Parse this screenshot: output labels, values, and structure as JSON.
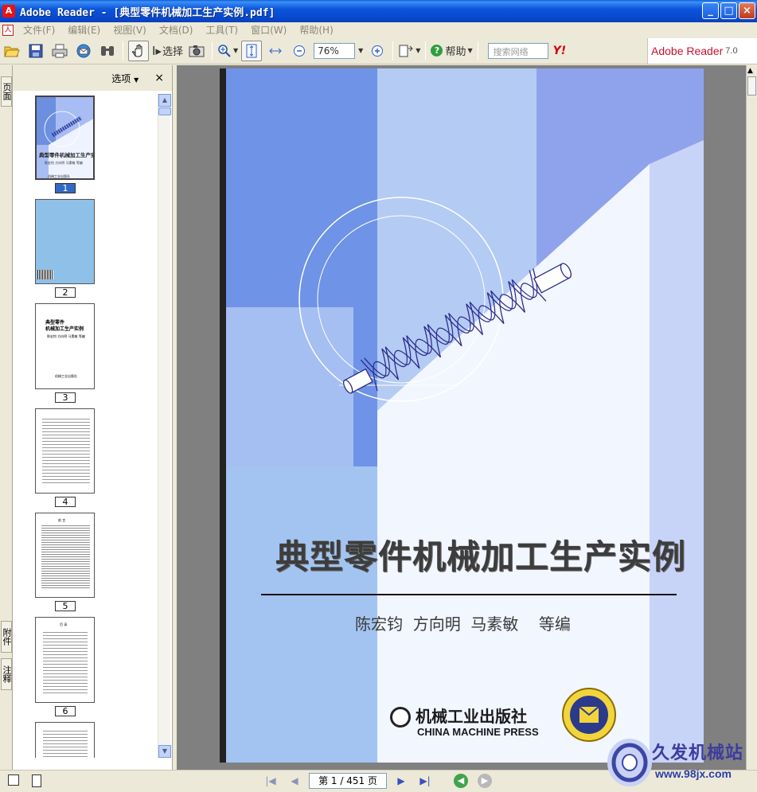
{
  "window": {
    "title": "Adobe Reader - [典型零件机械加工生产实例.pdf]"
  },
  "menu": [
    "文件(F)",
    "编辑(E)",
    "视图(V)",
    "文档(D)",
    "工具(T)",
    "窗口(W)",
    "帮助(H)"
  ],
  "toolbar": {
    "select_label": "选择",
    "zoom_value": "76%",
    "help_label": "帮助",
    "search_placeholder": "搜索网络",
    "yahoo_label": "Y!"
  },
  "brand": {
    "name": "Adobe Reader",
    "version": "7.0"
  },
  "side_tabs": {
    "pages": "页面",
    "attachments": "附件",
    "comments": "注释"
  },
  "nav_panel": {
    "options_label": "选项",
    "close_label": "×",
    "thumbnails": [
      {
        "page": "1",
        "selected": true
      },
      {
        "page": "2",
        "selected": false
      },
      {
        "page": "3",
        "selected": false
      },
      {
        "page": "4",
        "selected": false
      },
      {
        "page": "5",
        "selected": false
      },
      {
        "page": "6",
        "selected": false
      }
    ]
  },
  "page_cover": {
    "title": "典型零件机械加工生产实例",
    "authors": "陈宏钧  方向明  马素敏    等编",
    "publisher_cn": "机械工业出版社",
    "publisher_en": "CHINA MACHINE PRESS"
  },
  "thumb_text": {
    "t1_title": "典型零件机械加工生产实例",
    "t1_authors": "陈宏钧 方向明 马素敏 等编",
    "t1_pub": "机械工业出版社",
    "t3_title_line1": "典型零件",
    "t3_title_line2": "机械加工生产实例",
    "t3_authors": "陈宏钧 方向明 马素敏 等编",
    "t3_pub": "机械工业出版社",
    "t5_head": "前 言",
    "t6_head": "目 录"
  },
  "statusbar": {
    "page_display": "第 1 / 451 页"
  },
  "watermark": {
    "name": "久发机械站",
    "url": "www.98jx.com"
  },
  "colors": {
    "titlebar_blue": "#0846c9",
    "cover_blue": "#a6b8f2",
    "cover_dark": "#7f92e6",
    "title_text": "#3d3d3d"
  }
}
